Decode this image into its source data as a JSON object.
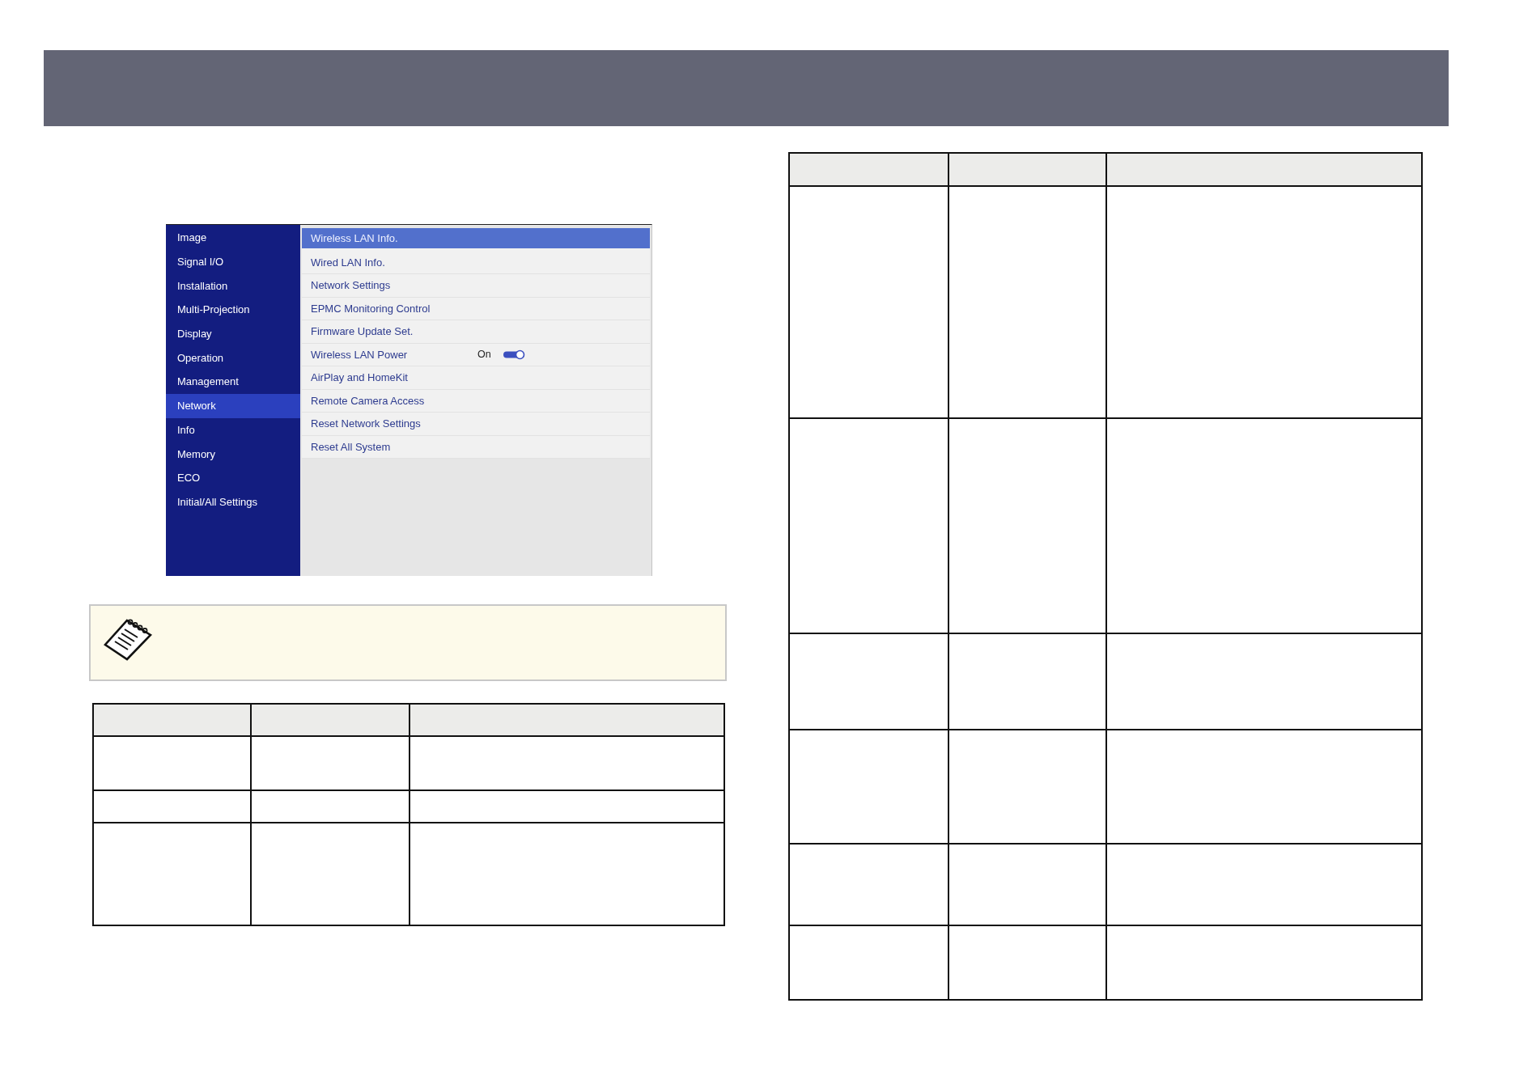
{
  "menu": {
    "sidebar": {
      "items": [
        {
          "label": "Image",
          "selected": false
        },
        {
          "label": "Signal I/O",
          "selected": false
        },
        {
          "label": "Installation",
          "selected": false
        },
        {
          "label": "Multi-Projection",
          "selected": false
        },
        {
          "label": "Display",
          "selected": false
        },
        {
          "label": "Operation",
          "selected": false
        },
        {
          "label": "Management",
          "selected": false
        },
        {
          "label": "Network",
          "selected": true
        },
        {
          "label": "Info",
          "selected": false
        },
        {
          "label": "Memory",
          "selected": false
        },
        {
          "label": "ECO",
          "selected": false
        },
        {
          "label": "Initial/All Settings",
          "selected": false
        }
      ]
    },
    "items": [
      {
        "kind": "plain",
        "label": "Wireless LAN Info.",
        "selected": true
      },
      {
        "kind": "plain",
        "label": "Wired LAN Info.",
        "selected": false
      },
      {
        "kind": "plain",
        "label": "Network Settings",
        "selected": false
      },
      {
        "kind": "plain",
        "label": "EPMC Monitoring Control",
        "selected": false
      },
      {
        "kind": "plain",
        "label": "Firmware Update Set.",
        "selected": false
      },
      {
        "kind": "toggle",
        "label": "Wireless LAN Power",
        "selected": false,
        "value": "On",
        "on": true
      },
      {
        "kind": "plain",
        "label": "AirPlay and HomeKit",
        "selected": false
      },
      {
        "kind": "plain",
        "label": "Remote Camera Access",
        "selected": false
      },
      {
        "kind": "plain",
        "label": "Reset Network Settings",
        "selected": false
      },
      {
        "kind": "plain",
        "label": "Reset All System",
        "selected": false
      }
    ]
  }
}
